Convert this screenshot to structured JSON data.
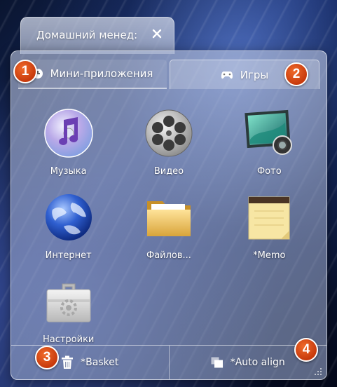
{
  "window": {
    "title": "Домашний менед:"
  },
  "tabs": [
    {
      "label": "Мини-приложения",
      "icon": "clock-icon",
      "active": true
    },
    {
      "label": "Игры",
      "icon": "gamepad-icon",
      "active": false
    }
  ],
  "apps": [
    {
      "label": "Музыка",
      "icon": "music-icon"
    },
    {
      "label": "Видео",
      "icon": "film-reel-icon"
    },
    {
      "label": "Фото",
      "icon": "photo-icon"
    },
    {
      "label": "Интернет",
      "icon": "globe-icon"
    },
    {
      "label": "Файлов...",
      "icon": "folder-icon"
    },
    {
      "label": "*Memo",
      "icon": "memo-icon"
    },
    {
      "label": "Настройки",
      "icon": "toolbox-icon"
    }
  ],
  "footer": {
    "basket_label": "*Basket",
    "align_label": "*Auto align"
  },
  "markers": [
    "1",
    "2",
    "3",
    "4"
  ],
  "colors": {
    "marker": "#d84a16",
    "panel": "#b4bfd8"
  }
}
